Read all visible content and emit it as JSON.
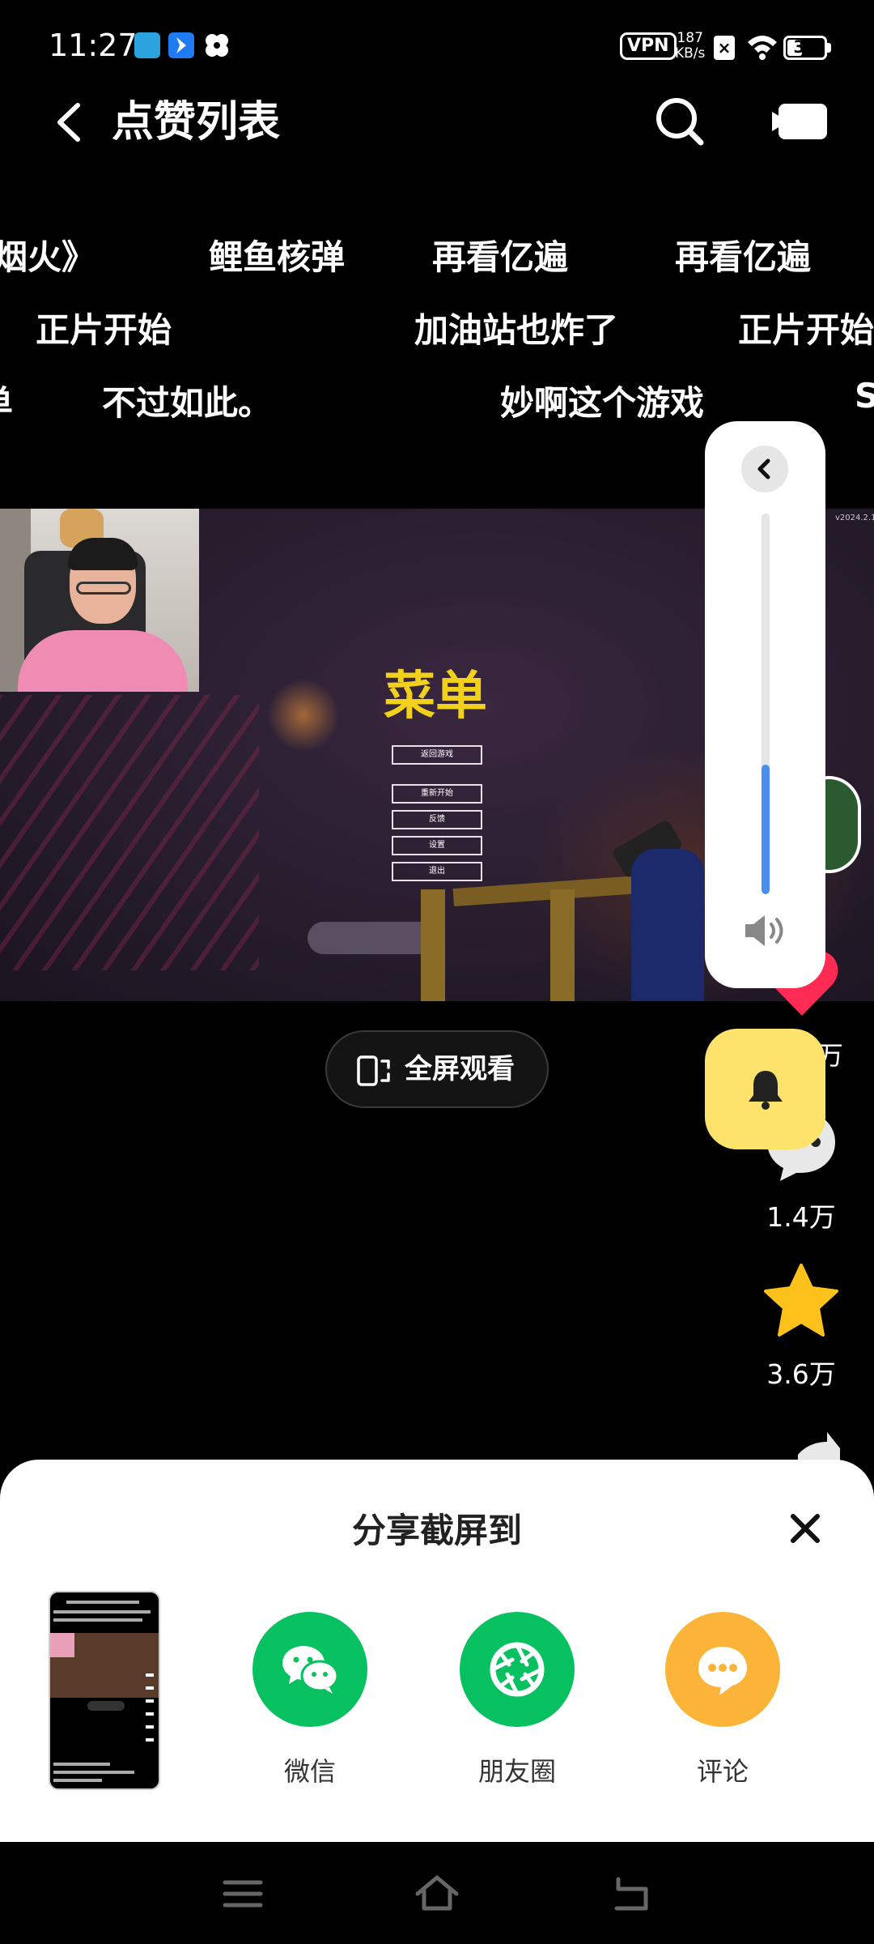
{
  "status_bar": {
    "time": "11:27",
    "vpn": "VPN",
    "net_speed_value": "187",
    "net_speed_unit": "KB/s",
    "battery": "37",
    "battery_level": 0.37,
    "app_icons": [
      "bilibili-icon",
      "app-arrow-icon",
      "app-pinwheel-icon"
    ]
  },
  "header": {
    "title": "点赞列表",
    "back_icon": "back-chevron-icon",
    "search_icon": "search-icon",
    "camera_icon": "video-camera-icon"
  },
  "danmaku": {
    "row1": [
      "烟火》",
      "鲤鱼核弹",
      "再看亿遍",
      "再看亿遍"
    ],
    "row2": [
      "正片开始",
      "加油站也炸了",
      "正片开始"
    ],
    "row3": [
      "单",
      "不过如此。",
      "妙啊这个游戏",
      "S"
    ]
  },
  "video": {
    "menu_title": "菜单",
    "menu_buttons": [
      "返回游戏",
      "重新开始",
      "反馈",
      "设置",
      "退出"
    ],
    "version": "v2024.2.1"
  },
  "fullscreen": {
    "label": "全屏观看"
  },
  "actions": {
    "like_count_partial": "万",
    "comment_count": "1.4万",
    "favorite_count": "3.6万"
  },
  "volume": {
    "level": 0.34
  },
  "share_sheet": {
    "title": "分享截屏到",
    "targets": [
      {
        "label": "微信",
        "color": "#07c160"
      },
      {
        "label": "朋友圈",
        "color": "#07c160"
      },
      {
        "label": "评论",
        "color": "#fbb438"
      }
    ]
  },
  "colors": {
    "accent_yellow": "#f1d11b",
    "like_red": "#fe2c55",
    "star_yellow": "#fcc21b",
    "volume_blue": "#4a8ef0",
    "bell_bg": "#fde36b"
  }
}
